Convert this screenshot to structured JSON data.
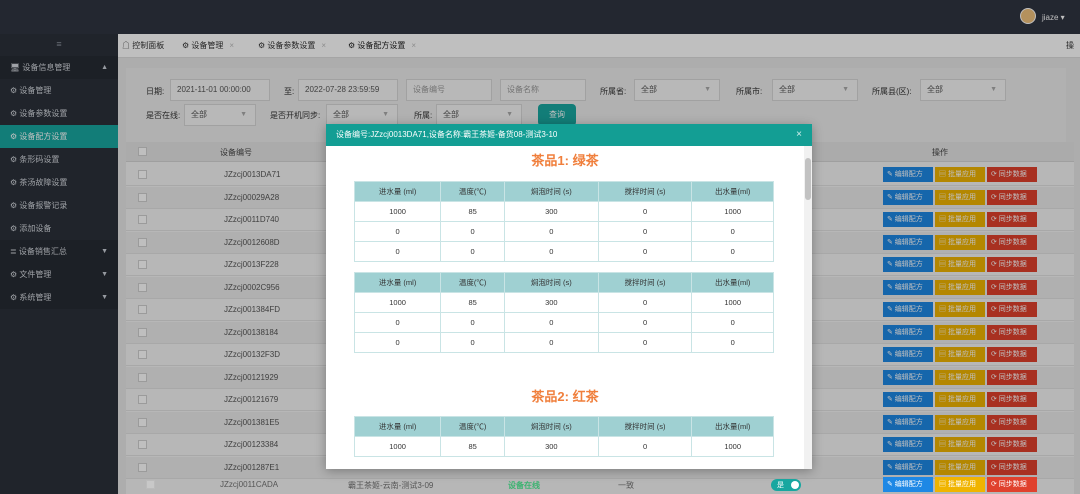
{
  "topbar": {
    "user": "jiaze ▾"
  },
  "sidebar": {
    "toggle": "≡",
    "items": [
      {
        "label": "🖥 设备信息管理",
        "caret": "▲"
      },
      {
        "label": "⚙ 设备管理"
      },
      {
        "label": "⚙ 设备参数设置"
      },
      {
        "label": "⚙ 设备配方设置"
      },
      {
        "label": "⚙ 条形码设置"
      },
      {
        "label": "⚙ 茶汤故障设置"
      },
      {
        "label": "⚙ 设备报警记录"
      },
      {
        "label": "⚙ 添加设备"
      },
      {
        "label": "≣ 设备销售汇总",
        "caret": "▼"
      },
      {
        "label": "⚙ 文件管理",
        "caret": "▼"
      },
      {
        "label": "⚙ 系统管理",
        "caret": "▼"
      }
    ]
  },
  "tabs": [
    {
      "label": "☖ 控制面板"
    },
    {
      "label": "⚙ 设备管理",
      "close": "×"
    },
    {
      "label": "⚙ 设备参数设置",
      "close": "×"
    },
    {
      "label": "⚙ 设备配方设置",
      "close": "×"
    }
  ],
  "tab_right": "操作",
  "filters": {
    "date_label": "日期:",
    "date_from": "2021-11-01 00:00:00",
    "to_label": "至:",
    "date_to": "2022-07-28 23:59:59",
    "device_no_placeholder": "设备编号",
    "device_name_placeholder": "设备名称",
    "province_label": "所属省:",
    "province_value": "全部",
    "city_label": "所属市:",
    "city_value": "全部",
    "county_label": "所属县(区):",
    "county_value": "全部",
    "online_label": "是否在线:",
    "online_value": "全部",
    "sync_label": "是否开机同步:",
    "sync_value": "全部",
    "belong_label": "所属:",
    "belong_value": "全部",
    "query": "查询",
    "dd": "▼"
  },
  "grid": {
    "col_device_no": "设备编号",
    "col_actions": "操作",
    "rows": [
      "JZzcj0013DA71",
      "JZzcj00029A28",
      "JZzcj0011D740",
      "JZzcj0012608D",
      "JZzcj0013F228",
      "JZzcj0002C956",
      "JZzcj001384FD",
      "JZzcj00138184",
      "JZzcj00132F3D",
      "JZzcj00121929",
      "JZzcj00121679",
      "JZzcj001381E5",
      "JZzcj00123384",
      "JZzcj001287E1",
      "JZzcj0011CADA"
    ],
    "btn_edit": "✎ 编辑配方",
    "btn_batch": "▤ 批量应用",
    "btn_sync": "⟳ 同步数据",
    "last_row": {
      "name": "霸王茶姬-云南-测试3-09",
      "status": "设备在线",
      "result": "一致",
      "toggle": "是"
    }
  },
  "modal": {
    "title": "设备编号:JZzcj0013DA71,设备名称:霸王茶姬-备货08-测试3-10",
    "close": "×",
    "tea1": "茶品1: 绿茶",
    "tea2": "茶品2: 红茶",
    "headers": [
      "进水量 (ml)",
      "温度(℃)",
      "焖泡时间 (s)",
      "搅拌时间 (s)",
      "出水量(ml)"
    ],
    "table1": [
      [
        "1000",
        "85",
        "300",
        "0",
        "1000"
      ],
      [
        "0",
        "0",
        "0",
        "0",
        "0"
      ],
      [
        "0",
        "0",
        "0",
        "0",
        "0"
      ]
    ],
    "table2": [
      [
        "1000",
        "85",
        "300",
        "0",
        "1000"
      ],
      [
        "0",
        "0",
        "0",
        "0",
        "0"
      ],
      [
        "0",
        "0",
        "0",
        "0",
        "0"
      ]
    ],
    "table3": [
      [
        "1000",
        "85",
        "300",
        "0",
        "1000"
      ]
    ]
  },
  "colors": {
    "accent": "#18a7a0",
    "modal_header": "#139e94",
    "tea_title": "#f07f3c",
    "table_header": "#9fd0d2"
  }
}
